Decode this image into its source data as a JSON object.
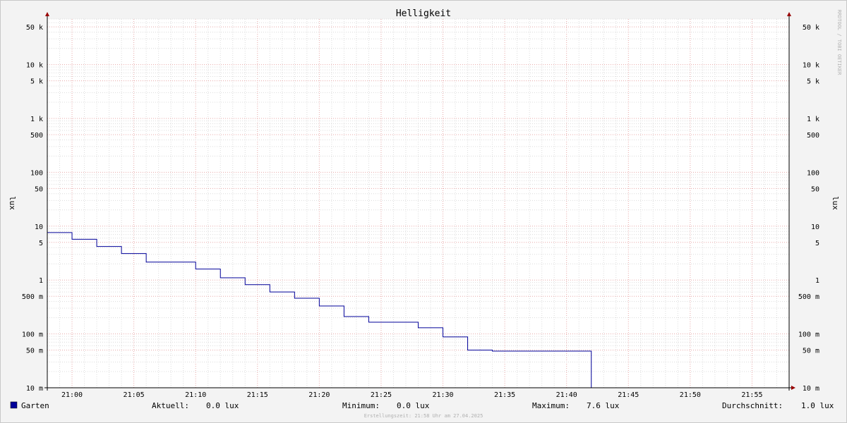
{
  "chart_data": {
    "type": "line",
    "title": "Helligkeit",
    "ylabel_left": "lux",
    "ylabel_right": "lux",
    "y_scale": "log",
    "ylim": [
      0.01,
      70000
    ],
    "y_ticks": [
      {
        "value": 50000,
        "label": "50 k"
      },
      {
        "value": 10000,
        "label": "10 k"
      },
      {
        "value": 5000,
        "label": "5 k"
      },
      {
        "value": 1000,
        "label": "1 k"
      },
      {
        "value": 500,
        "label": "500"
      },
      {
        "value": 100,
        "label": "100"
      },
      {
        "value": 50,
        "label": "50"
      },
      {
        "value": 10,
        "label": "10"
      },
      {
        "value": 5,
        "label": "5"
      },
      {
        "value": 1,
        "label": "1"
      },
      {
        "value": 0.5,
        "label": "500 m"
      },
      {
        "value": 0.1,
        "label": "100 m"
      },
      {
        "value": 0.05,
        "label": "50 m"
      },
      {
        "value": 0.01,
        "label": "10 m"
      }
    ],
    "xlim": [
      "20:58",
      "21:58"
    ],
    "x_ticks": [
      "21:00",
      "21:05",
      "21:10",
      "21:15",
      "21:20",
      "21:25",
      "21:30",
      "21:35",
      "21:40",
      "21:45",
      "21:50",
      "21:55"
    ],
    "grid": true,
    "series": [
      {
        "name": "Garten",
        "color": "#000099",
        "step": true,
        "x": [
          "20:58",
          "21:00",
          "21:02",
          "21:04",
          "21:06",
          "21:10",
          "21:12",
          "21:14",
          "21:16",
          "21:18",
          "21:20",
          "21:22",
          "21:24",
          "21:28",
          "21:30",
          "21:32",
          "21:34",
          "21:42",
          "21:58"
        ],
        "y": [
          7.6,
          5.7,
          4.2,
          3.1,
          2.15,
          1.6,
          1.1,
          0.82,
          0.6,
          0.46,
          0.33,
          0.21,
          0.165,
          0.13,
          0.088,
          0.05,
          0.048,
          0.01,
          0.01
        ]
      }
    ],
    "legend": {
      "entry": "Garten",
      "stats": [
        {
          "label": "Aktuell:",
          "value": "0.0 lux"
        },
        {
          "label": "Minimum:",
          "value": "0.0 lux"
        },
        {
          "label": "Maximum:",
          "value": "7.6 lux"
        },
        {
          "label": "Durchschnitt:",
          "value": "1.0 lux"
        }
      ]
    },
    "watermark": "RRDTOOL / TOBI OETIKER",
    "footer": "Erstellungszeit: 21:58 Uhr am 27.04.2025"
  }
}
